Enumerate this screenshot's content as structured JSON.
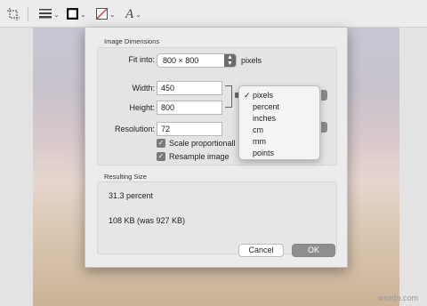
{
  "toolbar": {
    "icons": [
      "crop-icon",
      "line-style-icon",
      "border-color-icon",
      "fill-color-icon",
      "text-style-icon"
    ]
  },
  "dialog": {
    "image_dimensions_title": "Image Dimensions",
    "fit_into": {
      "label": "Fit into:",
      "value": "800 × 800",
      "unit": "pixels"
    },
    "width": {
      "label": "Width:",
      "value": "450"
    },
    "height": {
      "label": "Height:",
      "value": "800"
    },
    "resolution": {
      "label": "Resolution:",
      "value": "72"
    },
    "scale_proportionally": {
      "label": "Scale proportionall",
      "checked": true
    },
    "resample_image": {
      "label": "Resample image",
      "checked": true
    },
    "units_menu": {
      "selected": "pixels",
      "items": [
        "pixels",
        "percent",
        "inches",
        "cm",
        "mm",
        "points"
      ]
    },
    "resulting_size_title": "Resulting Size",
    "result_percent": "31.3 percent",
    "result_size": "108 KB (was 927 KB)",
    "cancel_label": "Cancel",
    "ok_label": "OK"
  },
  "watermark": "wsxdn.com",
  "colors": {
    "dialog_bg": "#ececec",
    "default_button": "#8e8e8e"
  }
}
